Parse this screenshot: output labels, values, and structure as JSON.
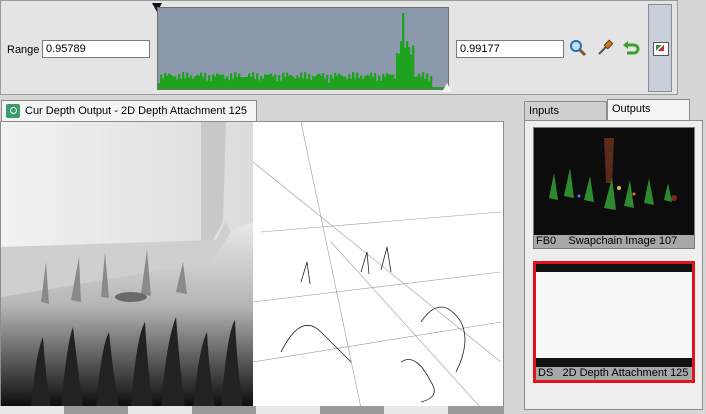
{
  "range": {
    "label": "Range",
    "min_value": "0.95789",
    "max_value": "0.99177"
  },
  "toolbar": {
    "zoom_icon": "magnifier-icon",
    "pick_icon": "eyedropper-icon",
    "reset_icon": "undo-arrow-icon",
    "histogram_toggle_icon": "histogram-icon"
  },
  "colors": {
    "histogram_bg": "#8c98ab",
    "histogram_bars": "#1fa31f",
    "selected_border": "#e0141e"
  },
  "main_tab": {
    "title": "Cur Depth Output - 2D Depth Attachment 125"
  },
  "io_tabs": {
    "inputs": "Inputs",
    "outputs": "Outputs"
  },
  "outputs": [
    {
      "slot": "FB0",
      "name": "Swapchain Image 107"
    },
    {
      "slot": "DS",
      "name": "2D Depth Attachment 125"
    }
  ]
}
